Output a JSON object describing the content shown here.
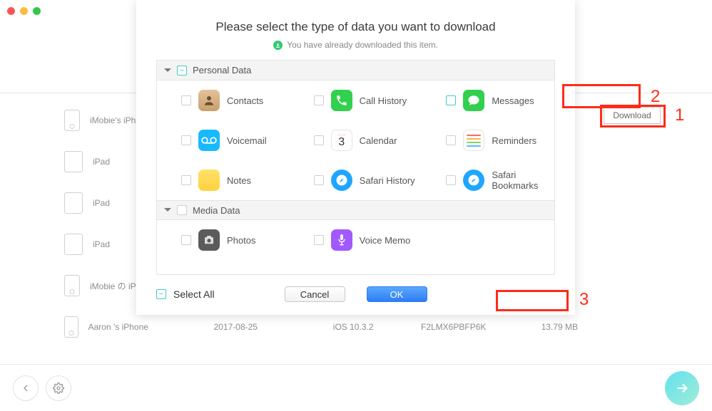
{
  "window": {
    "title_hint": ""
  },
  "background": {
    "download_button": "Download",
    "devices": [
      {
        "name": "iMobie's iPh",
        "kind": "iphone"
      },
      {
        "name": "iPad",
        "kind": "ipad"
      },
      {
        "name": "iPad",
        "kind": "ipad"
      },
      {
        "name": "iPad",
        "kind": "ipad"
      },
      {
        "name": "iMobie の iP",
        "kind": "iphone"
      },
      {
        "name": "Aaron 's iPhone",
        "kind": "iphone",
        "date": "2017-08-25",
        "os": "iOS 10.3.2",
        "id": "F2LMX6PBFP6K",
        "size": "13.79 MB"
      }
    ]
  },
  "modal": {
    "title": "Please select the type of data you want to download",
    "subtitle": "You have already downloaded this item.",
    "categories": [
      {
        "name": "Personal Data",
        "state": "partial",
        "items": [
          {
            "label": "Contacts",
            "icon": "contacts",
            "checked": false
          },
          {
            "label": "Call History",
            "icon": "callh",
            "checked": false
          },
          {
            "label": "Messages",
            "icon": "msg",
            "checked": true
          },
          {
            "label": "Voicemail",
            "icon": "vm",
            "checked": false
          },
          {
            "label": "Calendar",
            "icon": "cal",
            "checked": false
          },
          {
            "label": "Reminders",
            "icon": "rem",
            "checked": false
          },
          {
            "label": "Notes",
            "icon": "notes",
            "checked": false
          },
          {
            "label": "Safari History",
            "icon": "saf",
            "checked": false
          },
          {
            "label": "Safari Bookmarks",
            "icon": "saf",
            "checked": false
          }
        ]
      },
      {
        "name": "Media Data",
        "state": "none",
        "items": [
          {
            "label": "Photos",
            "icon": "photos",
            "checked": false
          },
          {
            "label": "Voice Memo",
            "icon": "voice",
            "checked": false
          }
        ]
      }
    ],
    "select_all": "Select All",
    "select_all_state": "partial",
    "cancel": "Cancel",
    "ok": "OK",
    "calendar_day": "3",
    "calendar_dots": "……"
  },
  "annotations": {
    "one": "1",
    "two": "2",
    "three": "3"
  }
}
